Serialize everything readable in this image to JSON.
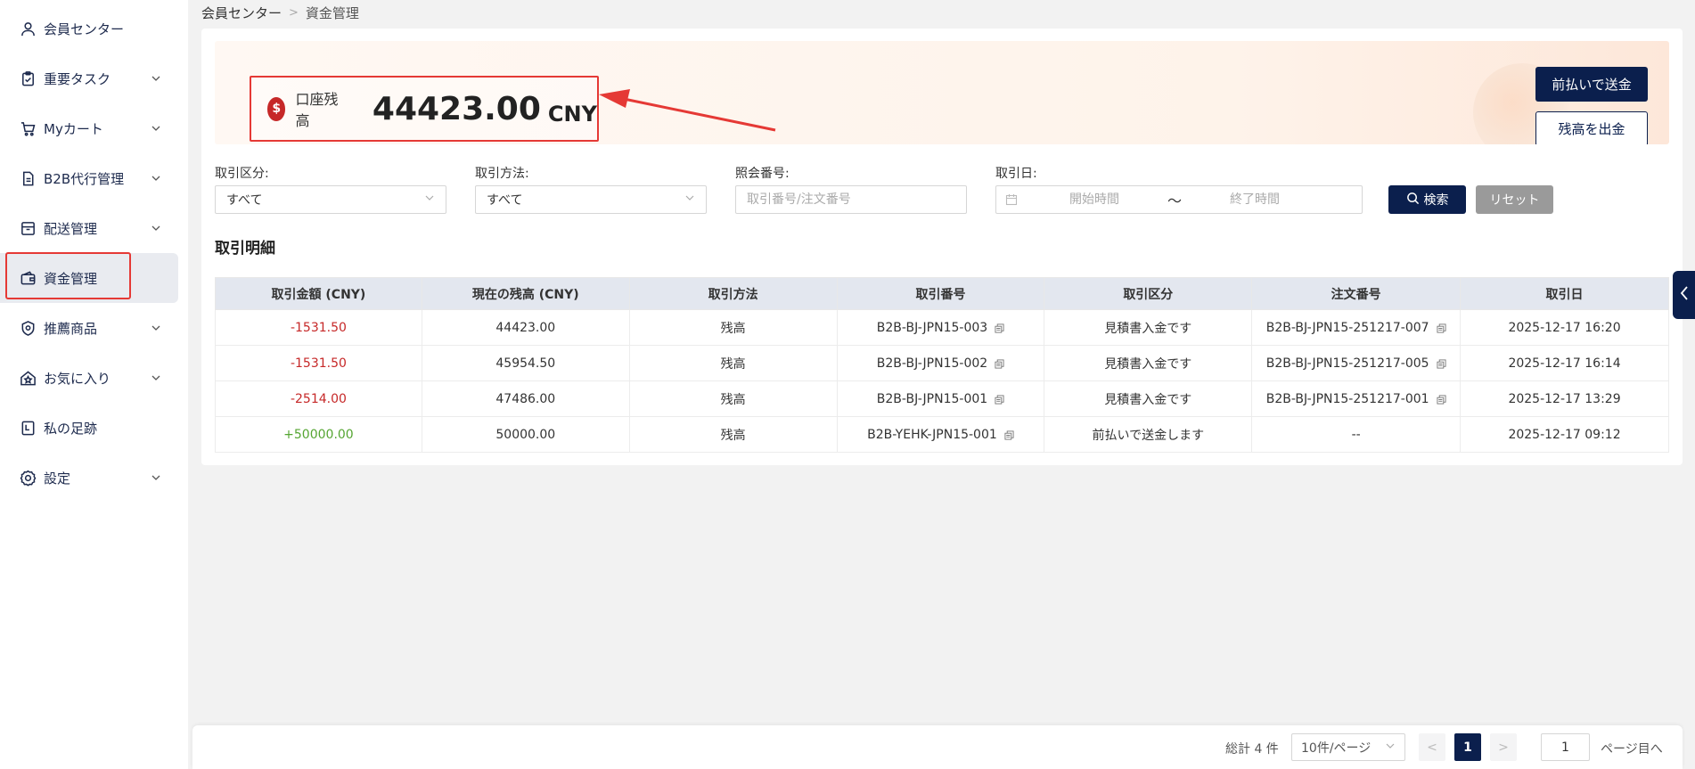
{
  "sidebar": {
    "items": [
      {
        "label": "会員センター",
        "icon": "user-icon",
        "has_children": false
      },
      {
        "label": "重要タスク",
        "icon": "clipboard-icon",
        "has_children": true
      },
      {
        "label": "Myカート",
        "icon": "cart-icon",
        "has_children": true
      },
      {
        "label": "B2B代行管理",
        "icon": "document-icon",
        "has_children": true
      },
      {
        "label": "配送管理",
        "icon": "box-icon",
        "has_children": true
      },
      {
        "label": "資金管理",
        "icon": "wallet-icon",
        "has_children": false,
        "active": true
      },
      {
        "label": "推薦商品",
        "icon": "shield-star-icon",
        "has_children": true
      },
      {
        "label": "お気に入り",
        "icon": "star-home-icon",
        "has_children": true
      },
      {
        "label": "私の足跡",
        "icon": "footprint-icon",
        "has_children": false
      },
      {
        "label": "設定",
        "icon": "gear-icon",
        "has_children": true
      }
    ]
  },
  "breadcrumb": {
    "root": "会員センター",
    "separator": ">",
    "current": "資金管理"
  },
  "balance": {
    "label": "口座残高",
    "amount": "44423.00",
    "unit": "CNY",
    "icon": "money-bag-icon"
  },
  "actions": {
    "prepay": "前払いで送金",
    "withdraw": "残高を出金"
  },
  "filters": {
    "type": {
      "label": "取引区分:",
      "value": "すべて"
    },
    "method": {
      "label": "取引方法:",
      "value": "すべて"
    },
    "ref": {
      "label": "照会番号:",
      "placeholder": "取引番号/注文番号"
    },
    "date": {
      "label": "取引日:",
      "start_placeholder": "開始時間",
      "end_placeholder": "終了時間",
      "separator": "〜"
    },
    "search": "検索",
    "reset": "リセット"
  },
  "section_title": "取引明細",
  "table": {
    "columns": [
      "取引金額 (CNY)",
      "現在の残高 (CNY)",
      "取引方法",
      "取引番号",
      "取引区分",
      "注文番号",
      "取引日"
    ],
    "rows": [
      {
        "amount": "-1531.50",
        "sign": "neg",
        "balance": "44423.00",
        "method": "残高",
        "txn": "B2B-BJ-JPN15-003",
        "type": "見積書入金です",
        "order": "B2B-BJ-JPN15-251217-007",
        "date": "2025-12-17 16:20"
      },
      {
        "amount": "-1531.50",
        "sign": "neg",
        "balance": "45954.50",
        "method": "残高",
        "txn": "B2B-BJ-JPN15-002",
        "type": "見積書入金です",
        "order": "B2B-BJ-JPN15-251217-005",
        "date": "2025-12-17 16:14"
      },
      {
        "amount": "-2514.00",
        "sign": "neg",
        "balance": "47486.00",
        "method": "残高",
        "txn": "B2B-BJ-JPN15-001",
        "type": "見積書入金です",
        "order": "B2B-BJ-JPN15-251217-001",
        "date": "2025-12-17 13:29"
      },
      {
        "amount": "+50000.00",
        "sign": "pos",
        "balance": "50000.00",
        "method": "残高",
        "txn": "B2B-YEHK-JPN15-001",
        "type": "前払いで送金します",
        "order": "--",
        "date": "2025-12-17 09:12"
      }
    ]
  },
  "pagination": {
    "total": "総計 4 件",
    "page_size": "10件/ページ",
    "prev": "<",
    "current_page": "1",
    "next": ">",
    "jump_value": "1",
    "jump_label": "ページ目へ"
  },
  "colors": {
    "primary": "#0b1f4d",
    "negative": "#c62828",
    "positive": "#55a532",
    "highlight": "#e53935"
  }
}
